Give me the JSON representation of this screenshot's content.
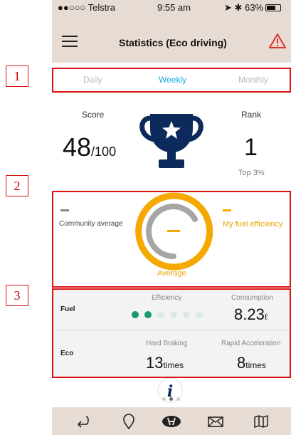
{
  "status_bar": {
    "carrier": "●●○○○ Telstra",
    "time": "9:55 am",
    "battery": "63%"
  },
  "nav": {
    "title": "Statistics (Eco driving)",
    "menu_icon": "hamburger-menu-icon",
    "alert_icon": "warning-triangle-icon"
  },
  "tabs": [
    {
      "label": "Daily",
      "active": false
    },
    {
      "label": "Weekly",
      "active": true
    },
    {
      "label": "Monthly",
      "active": false
    }
  ],
  "score": {
    "label": "Score",
    "value": "48",
    "max": "/100"
  },
  "rank": {
    "label": "Rank",
    "value": "1",
    "top": "Top 3%"
  },
  "comparison": {
    "community_label": "Community average",
    "fuel_label": "My fuel efficiency",
    "gauge_label": "Average"
  },
  "stats": {
    "fuel": {
      "label": "Fuel",
      "efficiency_header": "Efficiency",
      "efficiency_dots_filled": 2,
      "efficiency_dots_total": 6,
      "consumption_header": "Consumption",
      "consumption_value": "8.23",
      "consumption_unit": "ℓ"
    },
    "eco": {
      "label": "Eco",
      "hard_braking_header": "Hard Braking",
      "hard_braking_value": "13",
      "hard_braking_unit": "times",
      "rapid_acc_header": "Rapid Acceleration",
      "rapid_acc_value": "8",
      "rapid_acc_unit": "times"
    }
  },
  "bottom_tabs": [
    "return-icon",
    "location-pin-icon",
    "hyundai-logo-icon",
    "mail-icon",
    "map-icon"
  ],
  "annotations": [
    "1",
    "2",
    "3"
  ],
  "colors": {
    "accent_blue": "#1aa6d8",
    "accent_orange": "#f5a800",
    "green": "#179a6c",
    "navy": "#0d2a5c",
    "warning_red": "#e23030",
    "bar_bg": "#e7dcd3"
  }
}
